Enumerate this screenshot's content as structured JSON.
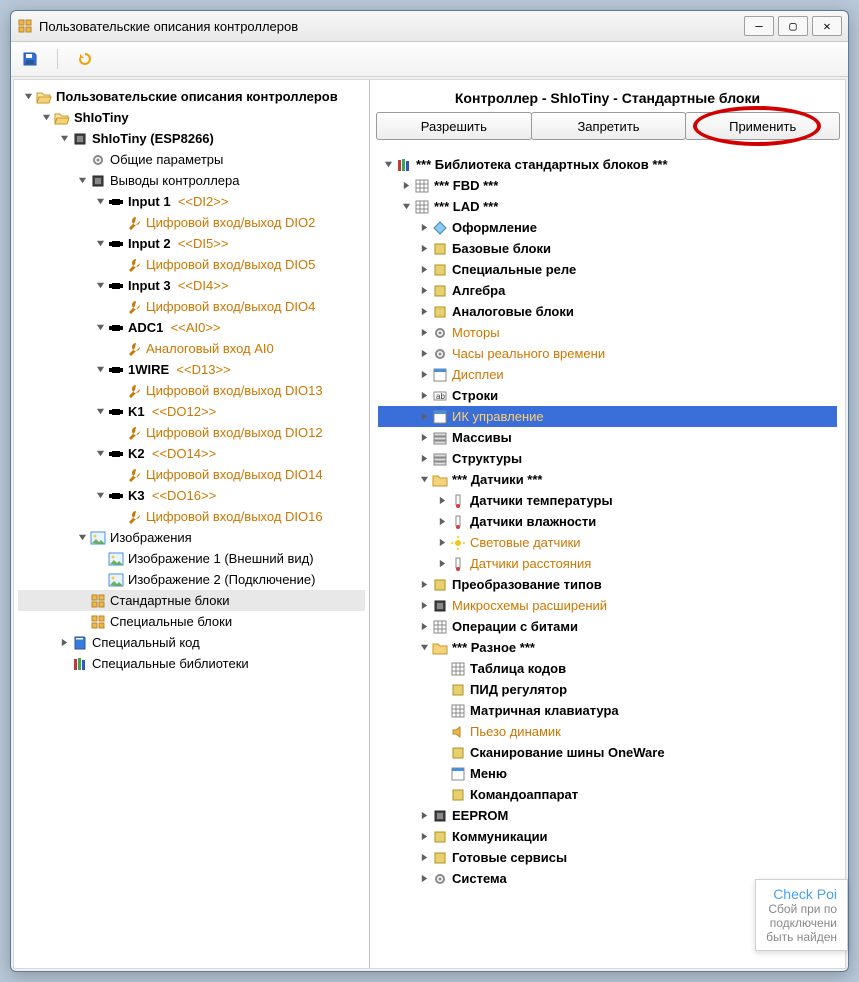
{
  "window": {
    "title": "Пользовательские описания контроллеров"
  },
  "leftTree": {
    "root": "Пользовательские описания контроллеров",
    "shioTiny": "ShIoTiny",
    "shioTinyEsp": "ShIoTiny (ESP8266)",
    "general": "Общие параметры",
    "pins": "Выводы контроллера",
    "input1": "Input 1",
    "input1_pin": "<<DI2>>",
    "dio2": "Цифровой вход/выход DIO2",
    "input2": "Input 2",
    "input2_pin": "<<DI5>>",
    "dio5": "Цифровой вход/выход DIO5",
    "input3": "Input 3",
    "input3_pin": "<<DI4>>",
    "dio4": "Цифровой вход/выход DIO4",
    "adc1": "ADC1",
    "adc1_pin": "<<AI0>>",
    "ai0": "Аналоговый вход AI0",
    "onewire": "1WIRE",
    "onewire_pin": "<<D13>>",
    "dio13": "Цифровой вход/выход DIO13",
    "k1": "K1",
    "k1_pin": "<<DO12>>",
    "dio12": "Цифровой вход/выход DIO12",
    "k2": "K2",
    "k2_pin": "<<DO14>>",
    "dio14": "Цифровой вход/выход DIO14",
    "k3": "K3",
    "k3_pin": "<<DO16>>",
    "dio16": "Цифровой вход/выход DIO16",
    "images": "Изображения",
    "img1": "Изображение 1 (Внешний вид)",
    "img2": "Изображение 2 (Подключение)",
    "stdBlocks": "Стандартные блоки",
    "specBlocks": "Специальные блоки",
    "specCode": "Специальный код",
    "specLibs": "Специальные библиотеки"
  },
  "right": {
    "header": "Контроллер - ShIoTiny - Стандартные блоки",
    "btn_allow": "Разрешить",
    "btn_deny": "Запретить",
    "btn_apply": "Применить",
    "lib": "*** Библиотека стандартных блоков ***",
    "fbd": "*** FBD ***",
    "lad": "*** LAD ***",
    "design": "Оформление",
    "base": "Базовые блоки",
    "relays": "Специальные реле",
    "algebra": "Алгебра",
    "analog": "Аналоговые блоки",
    "motors": "Моторы",
    "rtc": "Часы реального времени",
    "displays": "Дисплеи",
    "strings": "Строки",
    "ir": "ИК управление",
    "arrays": "Массивы",
    "structs": "Структуры",
    "sensors": "*** Датчики ***",
    "s_temp": "Датчики температуры",
    "s_hum": "Датчики влажности",
    "s_light": "Световые датчики",
    "s_dist": "Датчики расстояния",
    "cast": "Преобразование типов",
    "chips": "Микросхемы расширений",
    "bits": "Операции с битами",
    "misc": "*** Разное ***",
    "m_codes": "Таблица кодов",
    "m_pid": "ПИД регулятор",
    "m_matrix": "Матричная клавиатура",
    "m_piezo": "Пьезо динамик",
    "m_onewire": "Сканирование шины OneWare",
    "m_menu": "Меню",
    "m_cmd": "Командоаппарат",
    "eeprom": "EEPROM",
    "comm": "Коммуникации",
    "services": "Готовые сервисы",
    "system": "Система"
  },
  "toast": {
    "h": "Check Poi",
    "l1": "Сбой при по",
    "l2": "подключени",
    "l3": "быть найден"
  }
}
